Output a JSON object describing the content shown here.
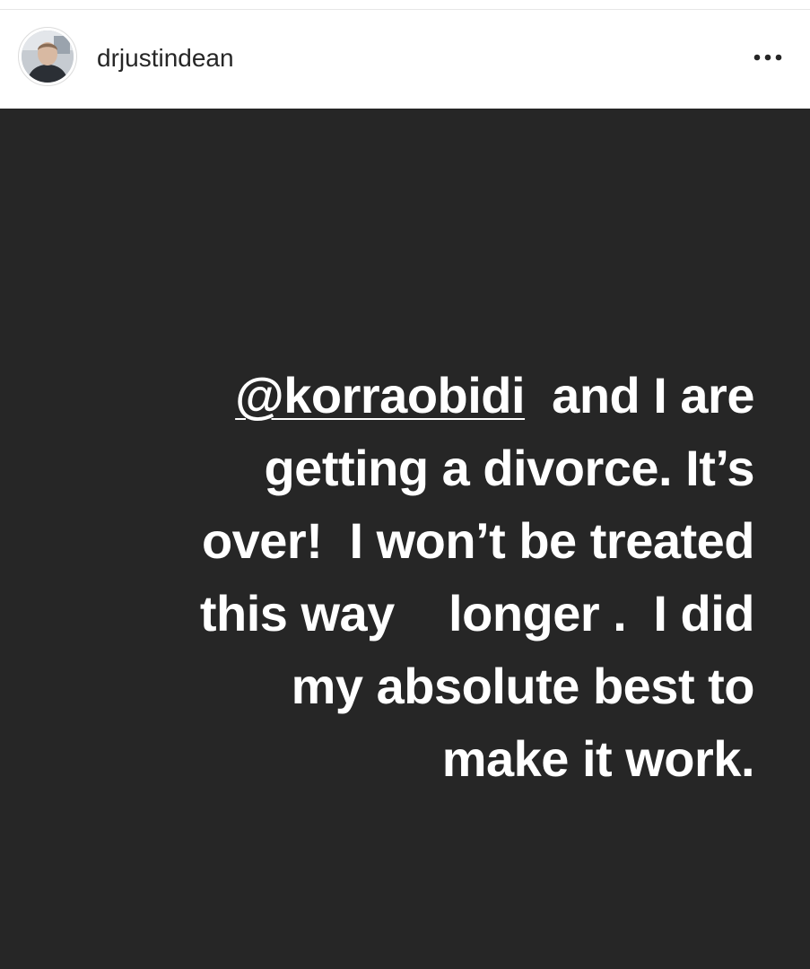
{
  "post": {
    "username": "drjustindean",
    "more_label": "•••"
  },
  "story": {
    "mention": "@korraobidi",
    "lines": [
      "  and I are",
      "getting a divorce. It’s",
      "over!  I won’t be treated",
      "this way    longer .  I did",
      "my absolute best to",
      "make it work."
    ]
  },
  "colors": {
    "story_background": "#262626",
    "text": "#ffffff",
    "username": "#262626"
  },
  "icons": {
    "avatar": "profile-photo",
    "more": "more-options-icon"
  }
}
